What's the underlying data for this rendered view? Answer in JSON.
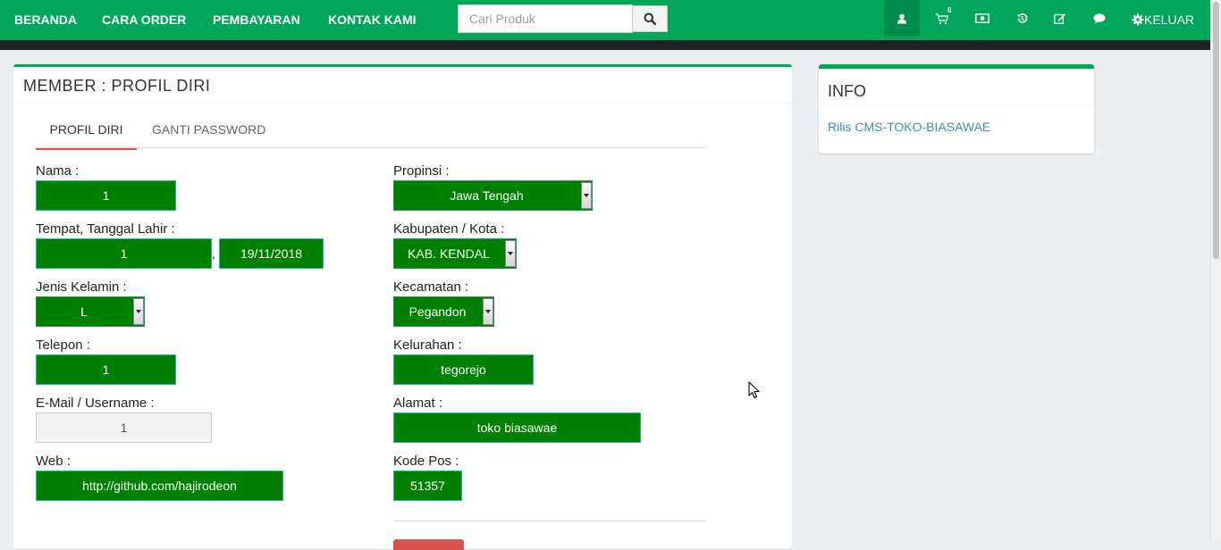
{
  "nav": {
    "links": [
      "BERANDA",
      "CARA ORDER",
      "PEMBAYARAN",
      "KONTAK KAMI"
    ],
    "search_placeholder": "Cari Produk",
    "cart_count": "0",
    "logout_label": "KELUAR"
  },
  "panel": {
    "title": "MEMBER : PROFIL DIRI",
    "tabs": [
      "PROFIL DIRI",
      "GANTI PASSWORD"
    ]
  },
  "form": {
    "nama_label": "Nama :",
    "nama_value": "1",
    "ttl_label": "Tempat, Tanggal Lahir :",
    "tempat_value": "1",
    "ttl_sep": ",",
    "tanggal_value": "19/11/2018",
    "jk_label": "Jenis Kelamin :",
    "jk_value": "L",
    "telepon_label": "Telepon :",
    "telepon_value": "1",
    "email_label": "E-Mail / Username :",
    "email_value": "1",
    "web_label": "Web :",
    "web_value": "http://github.com/hajirodeon",
    "propinsi_label": "Propinsi :",
    "propinsi_value": "Jawa Tengah",
    "kab_label": "Kabupaten / Kota :",
    "kab_value": "KAB. KENDAL",
    "kec_label": "Kecamatan :",
    "kec_value": "Pegandon",
    "kel_label": "Kelurahan :",
    "kel_value": "tegorejo",
    "alamat_label": "Alamat :",
    "alamat_value": "toko biasawae",
    "kodepos_label": "Kode Pos :",
    "kodepos_value": "51357"
  },
  "info": {
    "title": "INFO",
    "link": "Rilis CMS-TOKO-BIASAWAE"
  },
  "colors": {
    "brand": "#00a65a",
    "field_bg": "#008000",
    "accent_red": "#e74c3c",
    "link": "#3c8dbc"
  }
}
